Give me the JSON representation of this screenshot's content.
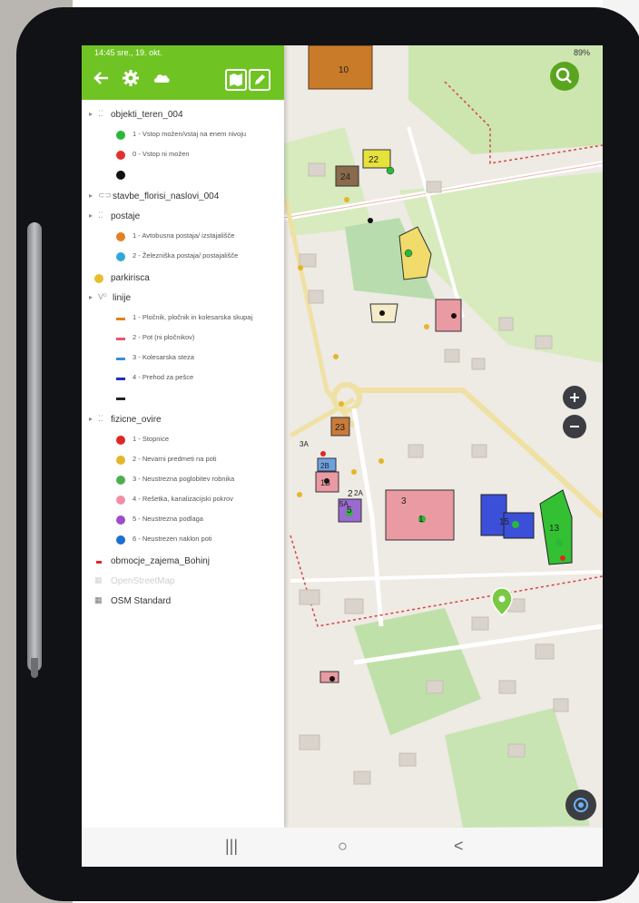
{
  "status": {
    "time": "14:45",
    "date": "sre., 19. okt.",
    "right": "89%"
  },
  "colors": {
    "accent": "#6fc424",
    "fab": "#5aa51f",
    "map_bg": "#eeeae4"
  },
  "toolbar": {
    "icons": [
      "back-arrow-icon",
      "gear-icon",
      "cloud-icon",
      "map-icon",
      "pencil-icon"
    ]
  },
  "layers": [
    {
      "label": "objekti_teren_004",
      "kind": "group"
    },
    {
      "label": "1 - Vstop možen/vstaj na enem nivoju",
      "kind": "item",
      "color": "#29b83a",
      "shape": "dot"
    },
    {
      "label": "0 - Vstop ni možen",
      "kind": "item",
      "color": "#e53030",
      "shape": "dot"
    },
    {
      "label": "",
      "kind": "item",
      "color": "#111111",
      "shape": "dot"
    },
    {
      "label": "stavbe_florisi_naslovi_004",
      "kind": "group"
    },
    {
      "label": "postaje",
      "kind": "group"
    },
    {
      "label": "1 - Avtobusna postaja/ izstajališče",
      "kind": "item",
      "color": "#e67e22",
      "shape": "dot"
    },
    {
      "label": "2 - Železniška postaja/ postajališče",
      "kind": "item",
      "color": "#33a8d8",
      "shape": "dot"
    },
    {
      "label": "parkirisca",
      "kind": "group-dot",
      "color": "#e5c02e"
    },
    {
      "label": "linije",
      "kind": "group"
    },
    {
      "label": "1 - Pločnik, pločnik in kolesarska skupaj",
      "kind": "item",
      "color": "#e67e22",
      "shape": "dash"
    },
    {
      "label": "2 - Pot (ni pločnikov)",
      "kind": "item",
      "color": "#e5566e",
      "shape": "dash"
    },
    {
      "label": "3 - Kolesarska steza",
      "kind": "item",
      "color": "#3a8fd8",
      "shape": "dash"
    },
    {
      "label": "4 - Prehod za pešce",
      "kind": "item",
      "color": "#2030c0",
      "shape": "dash"
    },
    {
      "label": "",
      "kind": "item",
      "color": "#222222",
      "shape": "dash"
    },
    {
      "label": "fizicne_ovire",
      "kind": "group"
    },
    {
      "label": "1 - Stopnice",
      "kind": "item",
      "color": "#e02626",
      "shape": "dot"
    },
    {
      "label": "2 - Nevarni predmeti na poti",
      "kind": "item",
      "color": "#e5b52a",
      "shape": "dot"
    },
    {
      "label": "3 - Neustrezna poglobitev robnika",
      "kind": "item",
      "color": "#4caf50",
      "shape": "dot"
    },
    {
      "label": "4 - Rešetka, kanalizacijski pokrov",
      "kind": "item",
      "color": "#f28fa6",
      "shape": "dot"
    },
    {
      "label": "5 - Neustrezna podlaga",
      "kind": "item",
      "color": "#9c4dc8",
      "shape": "dot"
    },
    {
      "label": "6 - Neustrezen naklon poti",
      "kind": "item",
      "color": "#1a6fd0",
      "shape": "dot"
    },
    {
      "label": "obmocje_zajema_Bohinj",
      "kind": "group-dash",
      "color": "#e02626"
    },
    {
      "label": "OpenStreetMap",
      "kind": "group-faded"
    },
    {
      "label": "OSM Standard",
      "kind": "group-grid"
    }
  ],
  "map_labels": [
    "10",
    "22",
    "24",
    "23",
    "1",
    "13",
    "15",
    "5",
    "2",
    "2A",
    "5A",
    "3",
    "1B",
    "2B",
    "3A"
  ],
  "nav": {
    "recent": "|||",
    "home": "○",
    "back": "<"
  }
}
